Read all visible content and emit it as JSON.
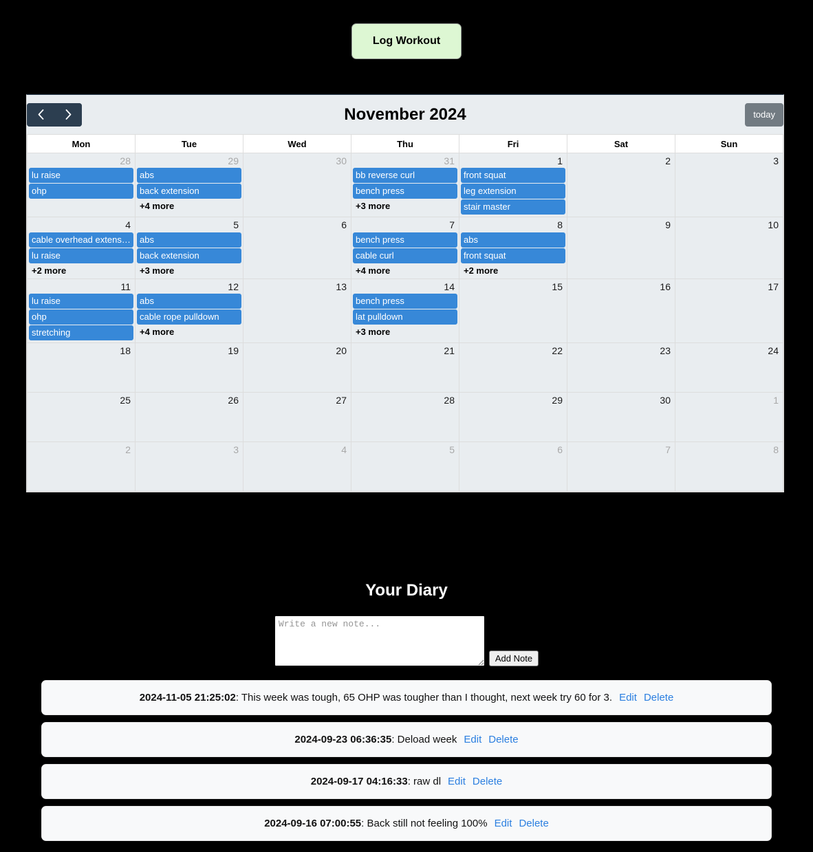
{
  "topbar": {
    "log_workout_label": "Log Workout"
  },
  "calendar": {
    "title": "November 2024",
    "prev_label": "‹",
    "next_label": "›",
    "today_label": "today",
    "weekdays": [
      "Mon",
      "Tue",
      "Wed",
      "Thu",
      "Fri",
      "Sat",
      "Sun"
    ],
    "accent_event_color": "#3788d8",
    "today_cell_color": "#edead9",
    "nav_button_color": "#2c3e50",
    "today_button_color": "#6c757d",
    "weeks": [
      [
        {
          "day": "28",
          "other_month": true,
          "today": false,
          "events": [
            "lu raise",
            "ohp"
          ],
          "more": ""
        },
        {
          "day": "29",
          "other_month": true,
          "today": false,
          "events": [
            "abs",
            "back extension"
          ],
          "more": "+4 more"
        },
        {
          "day": "30",
          "other_month": true,
          "today": false,
          "events": [],
          "more": ""
        },
        {
          "day": "31",
          "other_month": true,
          "today": false,
          "events": [
            "bb reverse curl",
            "bench press"
          ],
          "more": "+3 more"
        },
        {
          "day": "1",
          "other_month": false,
          "today": false,
          "events": [
            "front squat",
            "leg extension",
            "stair master"
          ],
          "more": ""
        },
        {
          "day": "2",
          "other_month": false,
          "today": false,
          "events": [],
          "more": ""
        },
        {
          "day": "3",
          "other_month": false,
          "today": false,
          "events": [],
          "more": ""
        }
      ],
      [
        {
          "day": "4",
          "other_month": false,
          "today": false,
          "events": [
            "cable overhead extension",
            "lu raise"
          ],
          "more": "+2 more"
        },
        {
          "day": "5",
          "other_month": false,
          "today": false,
          "events": [
            "abs",
            "back extension"
          ],
          "more": "+3 more"
        },
        {
          "day": "6",
          "other_month": false,
          "today": false,
          "events": [],
          "more": ""
        },
        {
          "day": "7",
          "other_month": false,
          "today": false,
          "events": [
            "bench press",
            "cable curl"
          ],
          "more": "+4 more"
        },
        {
          "day": "8",
          "other_month": false,
          "today": false,
          "events": [
            "abs",
            "front squat"
          ],
          "more": "+2 more"
        },
        {
          "day": "9",
          "other_month": false,
          "today": false,
          "events": [],
          "more": ""
        },
        {
          "day": "10",
          "other_month": false,
          "today": false,
          "events": [],
          "more": ""
        }
      ],
      [
        {
          "day": "11",
          "other_month": false,
          "today": false,
          "events": [
            "lu raise",
            "ohp",
            "stretching"
          ],
          "more": ""
        },
        {
          "day": "12",
          "other_month": false,
          "today": false,
          "events": [
            "abs",
            "cable rope pulldown"
          ],
          "more": "+4 more"
        },
        {
          "day": "13",
          "other_month": false,
          "today": false,
          "events": [],
          "more": ""
        },
        {
          "day": "14",
          "other_month": false,
          "today": true,
          "events": [
            "bench press",
            "lat pulldown"
          ],
          "more": "+3 more"
        },
        {
          "day": "15",
          "other_month": false,
          "today": false,
          "events": [],
          "more": ""
        },
        {
          "day": "16",
          "other_month": false,
          "today": false,
          "events": [],
          "more": ""
        },
        {
          "day": "17",
          "other_month": false,
          "today": false,
          "events": [],
          "more": ""
        }
      ],
      [
        {
          "day": "18",
          "other_month": false,
          "today": false,
          "events": [],
          "more": ""
        },
        {
          "day": "19",
          "other_month": false,
          "today": false,
          "events": [],
          "more": ""
        },
        {
          "day": "20",
          "other_month": false,
          "today": false,
          "events": [],
          "more": ""
        },
        {
          "day": "21",
          "other_month": false,
          "today": false,
          "events": [],
          "more": ""
        },
        {
          "day": "22",
          "other_month": false,
          "today": false,
          "events": [],
          "more": ""
        },
        {
          "day": "23",
          "other_month": false,
          "today": false,
          "events": [],
          "more": ""
        },
        {
          "day": "24",
          "other_month": false,
          "today": false,
          "events": [],
          "more": ""
        }
      ],
      [
        {
          "day": "25",
          "other_month": false,
          "today": false,
          "events": [],
          "more": ""
        },
        {
          "day": "26",
          "other_month": false,
          "today": false,
          "events": [],
          "more": ""
        },
        {
          "day": "27",
          "other_month": false,
          "today": false,
          "events": [],
          "more": ""
        },
        {
          "day": "28",
          "other_month": false,
          "today": false,
          "events": [],
          "more": ""
        },
        {
          "day": "29",
          "other_month": false,
          "today": false,
          "events": [],
          "more": ""
        },
        {
          "day": "30",
          "other_month": false,
          "today": false,
          "events": [],
          "more": ""
        },
        {
          "day": "1",
          "other_month": true,
          "today": false,
          "events": [],
          "more": ""
        }
      ],
      [
        {
          "day": "2",
          "other_month": true,
          "today": false,
          "events": [],
          "more": ""
        },
        {
          "day": "3",
          "other_month": true,
          "today": false,
          "events": [],
          "more": ""
        },
        {
          "day": "4",
          "other_month": true,
          "today": false,
          "events": [],
          "more": ""
        },
        {
          "day": "5",
          "other_month": true,
          "today": false,
          "events": [],
          "more": ""
        },
        {
          "day": "6",
          "other_month": true,
          "today": false,
          "events": [],
          "more": ""
        },
        {
          "day": "7",
          "other_month": true,
          "today": false,
          "events": [],
          "more": ""
        },
        {
          "day": "8",
          "other_month": true,
          "today": false,
          "events": [],
          "more": ""
        }
      ]
    ]
  },
  "diary": {
    "heading": "Your Diary",
    "new_note_value": "",
    "new_note_placeholder": "Write a new note...",
    "add_note_label": "Add Note",
    "edit_label": "Edit",
    "delete_label": "Delete",
    "notes": [
      {
        "timestamp": "2024-11-05 21:25:02",
        "text": ": This week was tough, 65 OHP was tougher than I thought, next week try 60 for 3."
      },
      {
        "timestamp": "2024-09-23 06:36:35",
        "text": ": Deload week"
      },
      {
        "timestamp": "2024-09-17 04:16:33",
        "text": ": raw dl"
      },
      {
        "timestamp": "2024-09-16 07:00:55",
        "text": ": Back still not feeling 100%"
      }
    ]
  }
}
